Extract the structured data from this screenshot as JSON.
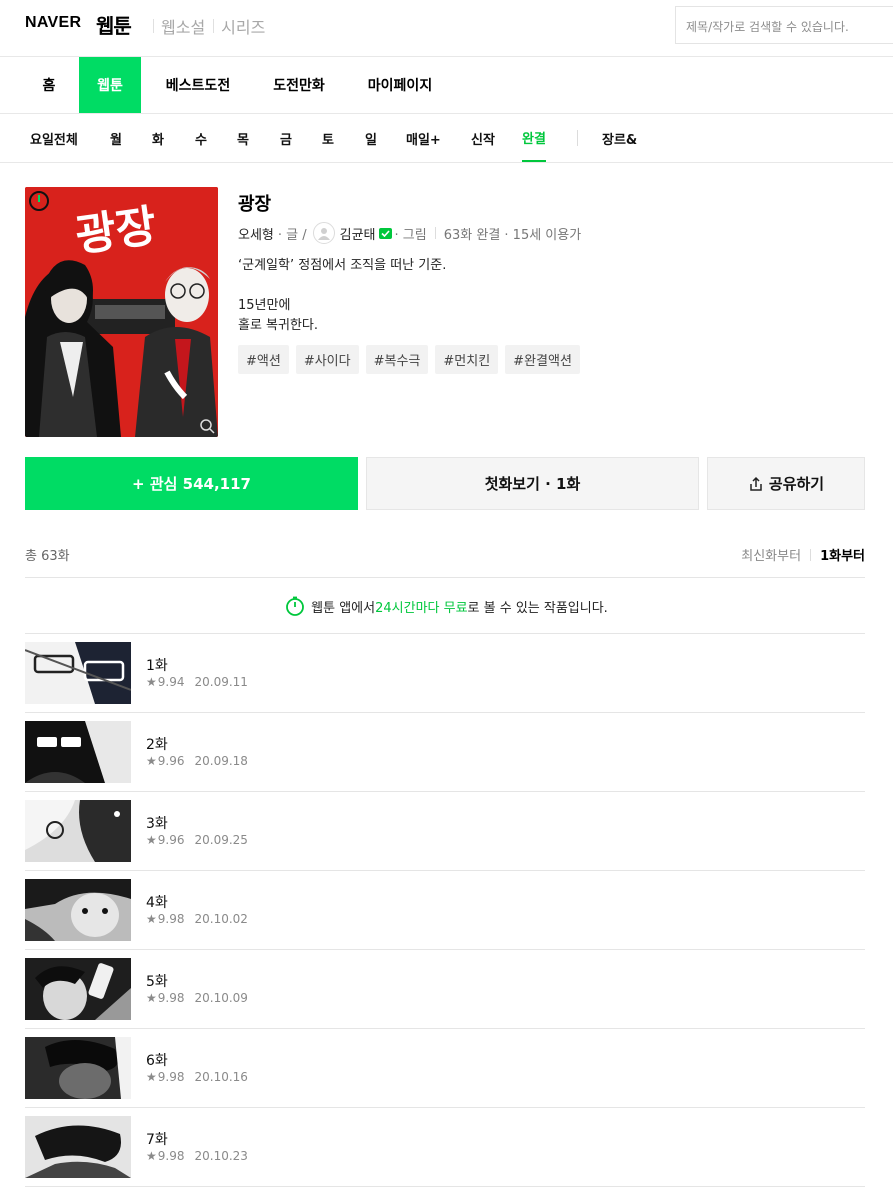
{
  "header": {
    "logo": "NAVER",
    "service": "웹툰",
    "links": [
      "웹소설",
      "시리즈"
    ],
    "search_placeholder": "제목/작가로 검색할 수 있습니다."
  },
  "main_nav": [
    "홈",
    "웹툰",
    "베스트도전",
    "도전만화",
    "마이페이지"
  ],
  "main_nav_active": "웹툰",
  "day_nav": [
    "요일전체",
    "월",
    "화",
    "수",
    "목",
    "금",
    "토",
    "일",
    "매일+",
    "신작",
    "완결",
    "장르&"
  ],
  "day_nav_active": "완결",
  "comic": {
    "title": "광장",
    "writer": "오세형",
    "writer_role": "· 글 /",
    "artist": "김균태",
    "artist_role": "· 그림",
    "status": "63화 완결 · 15세 이용가",
    "synopsis": [
      "‘군계일학’ 정점에서 조직을 떠난 기준.",
      "",
      "15년만에",
      "홀로 복귀한다."
    ],
    "tags": [
      "#액션",
      "#사이다",
      "#복수극",
      "#먼치킨",
      "#완결액션"
    ],
    "cover_title": "광장"
  },
  "buttons": {
    "interest": "+ 관심 544,117",
    "first_view": "첫화보기 · 1화",
    "share": "공유하기"
  },
  "list": {
    "total": "총 63화",
    "sort_latest": "최신화부터",
    "sort_first": "1화부터",
    "notice_prefix": "웹툰 앱에서 ",
    "notice_highlight": "24시간마다 무료",
    "notice_suffix": "로 볼 수 있는 작품입니다."
  },
  "episodes": [
    {
      "title": "1화",
      "rating": "9.94",
      "date": "20.09.11"
    },
    {
      "title": "2화",
      "rating": "9.96",
      "date": "20.09.18"
    },
    {
      "title": "3화",
      "rating": "9.96",
      "date": "20.09.25"
    },
    {
      "title": "4화",
      "rating": "9.98",
      "date": "20.10.02"
    },
    {
      "title": "5화",
      "rating": "9.98",
      "date": "20.10.09"
    },
    {
      "title": "6화",
      "rating": "9.98",
      "date": "20.10.16"
    },
    {
      "title": "7화",
      "rating": "9.98",
      "date": "20.10.23"
    }
  ],
  "colors": {
    "brand_green": "#00dc64",
    "highlight_green": "#00c73c",
    "cover_red": "#d8221c"
  }
}
